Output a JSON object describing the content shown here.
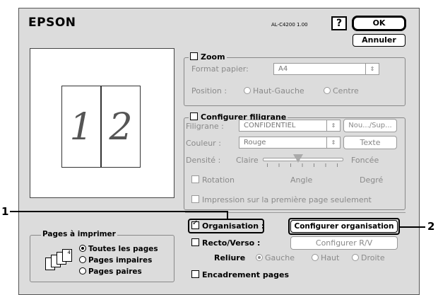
{
  "header": {
    "brand": "EPSON",
    "model": "AL-C4200 1.00",
    "help_label": "?",
    "ok_label": "OK",
    "cancel_label": "Annuler"
  },
  "preview": {
    "pages": [
      "1",
      "2"
    ]
  },
  "zoom": {
    "label": "Zoom",
    "checked": false,
    "format_label": "Format papier:",
    "format_value": "A4",
    "position_label": "Position :",
    "position_options": [
      "Haut-Gauche",
      "Centre"
    ]
  },
  "watermark": {
    "label": "Configurer filigrane",
    "checked": false,
    "filigrane_label": "Filigrane :",
    "filigrane_value": "CONFIDENTIEL",
    "new_button": "Nou.../Sup...",
    "couleur_label": "Couleur :",
    "couleur_value": "Rouge",
    "text_button": "Texte",
    "density_label": "Densité :",
    "density_min": "Claire",
    "density_max": "Foncée",
    "density_level": 0.45,
    "rotation_label": "Rotation",
    "angle_label": "Angle",
    "degree_label": "Degré",
    "first_page_label": "Impression sur la première page seulement"
  },
  "layout": {
    "organisation_label": "Organisation :",
    "organisation_checked": true,
    "config_org_button": "Configurer organisation",
    "duplex_label": "Recto/Verso :",
    "duplex_checked": false,
    "config_duplex_button": "Configurer R/V",
    "binding_label": "Reliure",
    "binding_options": [
      "Gauche",
      "Haut",
      "Droite"
    ],
    "frame_label": "Encadrement pages",
    "frame_checked": false
  },
  "pages_to_print": {
    "title": "Pages à imprimer",
    "options": [
      "Toutes les pages",
      "Pages impaires",
      "Pages paires"
    ],
    "selected": 0
  },
  "callouts": {
    "one": "1",
    "two": "2"
  }
}
